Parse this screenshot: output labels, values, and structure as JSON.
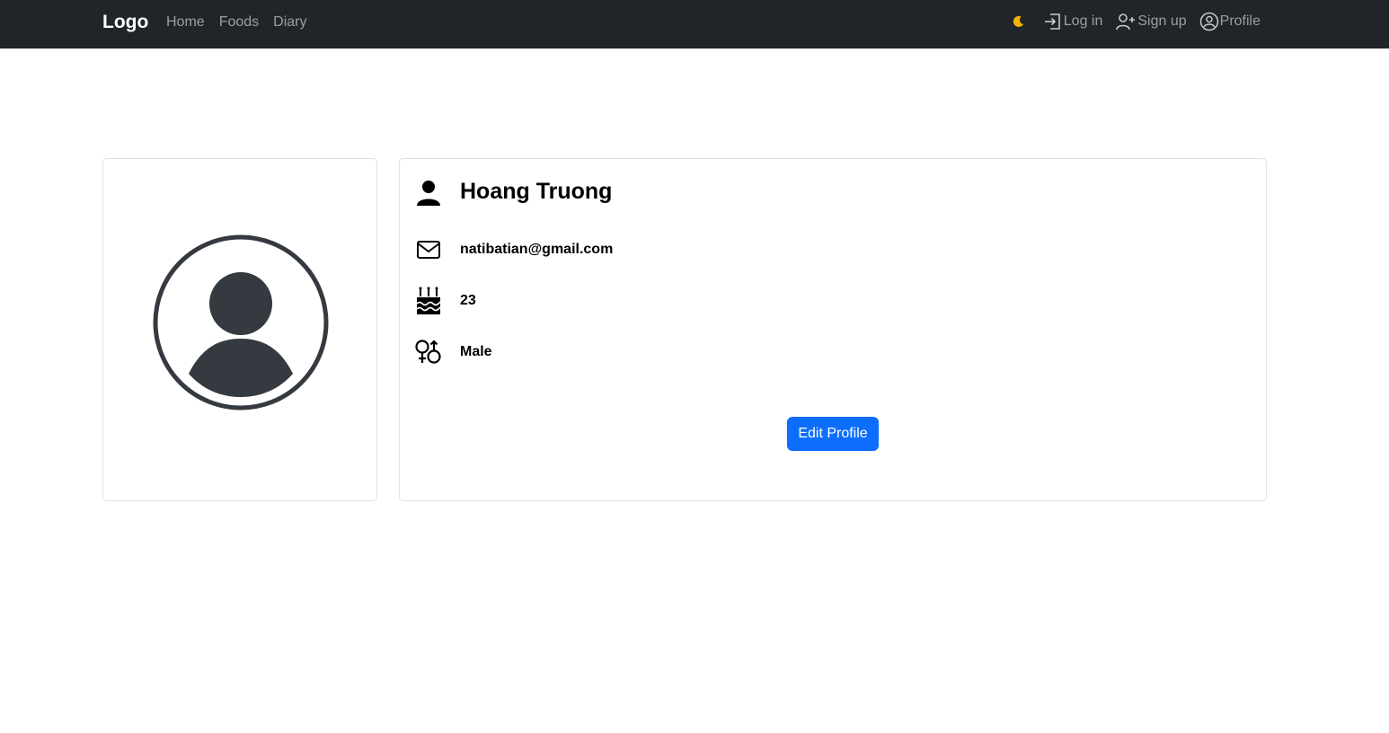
{
  "navbar": {
    "brand": "Logo",
    "links": [
      {
        "label": "Home"
      },
      {
        "label": "Foods"
      },
      {
        "label": "Diary"
      }
    ],
    "theme_icon": "moon-icon",
    "login_label": "Log in",
    "signup_label": "Sign up",
    "profile_label": "Profile"
  },
  "profile": {
    "name": "Hoang Truong",
    "email": "natibatian@gmail.com",
    "age": "23",
    "gender": "Male",
    "edit_button": "Edit Profile"
  },
  "colors": {
    "navbar_bg": "#212529",
    "primary": "#0d6efd",
    "avatar": "#343a40",
    "moon": "#f5b400"
  }
}
